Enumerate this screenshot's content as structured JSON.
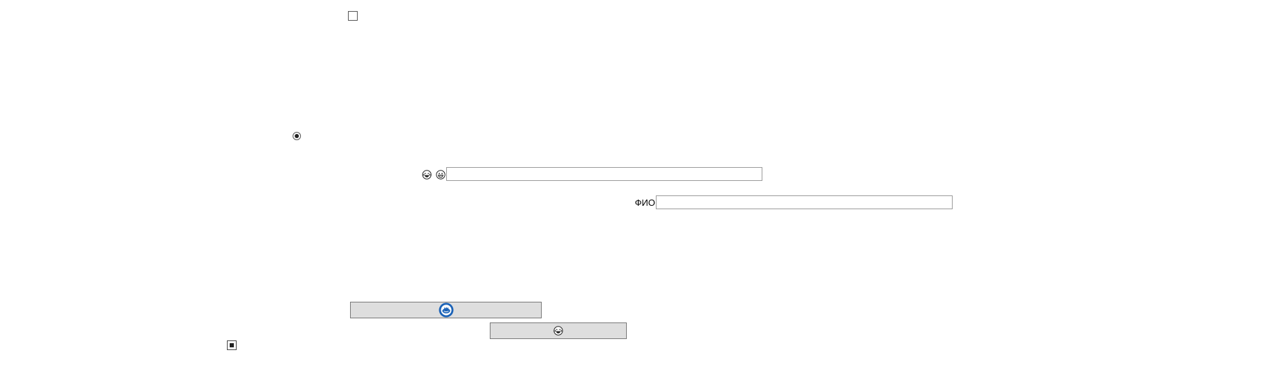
{
  "checkbox_top": {
    "checked": false
  },
  "radio": {
    "selected": true
  },
  "emoji_row": {
    "icons": [
      "laughing-face-icon",
      "grinning-face-icon"
    ],
    "input": {
      "value": "",
      "placeholder": ""
    }
  },
  "fio": {
    "label": "ФИО",
    "input": {
      "value": "",
      "placeholder": ""
    }
  },
  "button_primary": {
    "icon": "blue-round-logo-icon"
  },
  "button_secondary": {
    "icon": "laughing-face-icon"
  },
  "checkbox_bottom": {
    "checked": true
  },
  "colors": {
    "button_bg": "#dedede",
    "button_border": "#777777",
    "field_border": "#9a9a9a",
    "logo_blue": "#1c63b7"
  }
}
